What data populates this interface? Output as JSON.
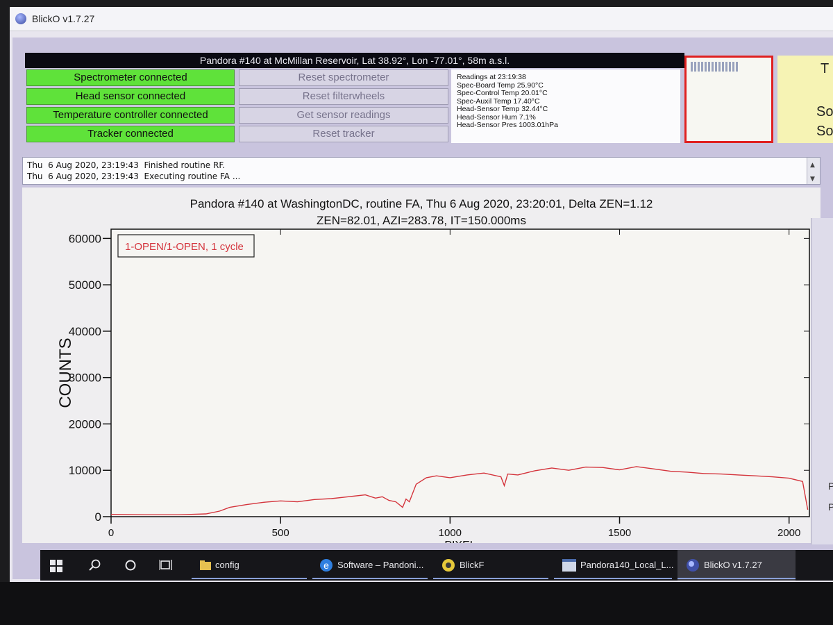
{
  "window": {
    "title": "BlickO v1.7.27"
  },
  "header": {
    "station": "Pandora #140 at McMillan Reservoir, Lat 38.92°, Lon -77.01°, 58m a.s.l.",
    "status": [
      {
        "label": "Spectrometer connected"
      },
      {
        "label": "Head sensor connected"
      },
      {
        "label": "Temperature controller connected"
      },
      {
        "label": "Tracker connected"
      }
    ],
    "actions": [
      {
        "label": "Reset spectrometer"
      },
      {
        "label": "Reset filterwheels"
      },
      {
        "label": "Get sensor readings"
      },
      {
        "label": "Reset tracker"
      }
    ],
    "readings": [
      "Readings at 23:19:38",
      "Spec-Board Temp 25.90°C",
      "Spec-Control Temp 20.01°C",
      "Spec-Auxil Temp 17.40°C",
      "Head-Sensor Temp 32.44°C",
      "Head-Sensor Hum 7.1%",
      "Head-Sensor Pres 1003.01hPa"
    ],
    "right_panel": {
      "t": "T",
      "s1": "So",
      "s2": "So"
    },
    "colors": {
      "connected": "#5fe23a",
      "mini_border": "#e02020"
    }
  },
  "log": {
    "lines": [
      "Thu  6 Aug 2020, 23:19:43  Finished routine RF.",
      "Thu  6 Aug 2020, 23:19:43  Executing routine FA ..."
    ],
    "scroll_up_icon": "chevron-up-icon",
    "scroll_down_icon": "chevron-down-icon"
  },
  "side_strip": {
    "a": "P",
    "b": "P"
  },
  "chart_data": {
    "type": "line",
    "title_line1": "Pandora #140 at WashingtonDC, routine FA, Thu  6 Aug 2020, 23:20:01, Delta ZEN=1.12",
    "title_line2": "ZEN=82.01, AZI=283.78, IT=150.000ms",
    "xlabel": "PIXEL",
    "ylabel": "COUNTS",
    "xlim": [
      0,
      2060
    ],
    "ylim": [
      0,
      62000
    ],
    "xticks": [
      0,
      500,
      1000,
      1500,
      2000
    ],
    "yticks": [
      0,
      10000,
      20000,
      30000,
      40000,
      50000,
      60000
    ],
    "legend": "1-OPEN/1-OPEN, 1 cycle",
    "legend_position": "top-left",
    "line_color": "#d4343c",
    "series": [
      {
        "x": [
          0,
          100,
          200,
          280,
          320,
          350,
          400,
          450,
          500,
          550,
          600,
          650,
          700,
          750,
          780,
          800,
          820,
          840,
          860,
          870,
          880,
          900,
          930,
          960,
          1000,
          1050,
          1100,
          1150,
          1160,
          1170,
          1200,
          1250,
          1300,
          1350,
          1400,
          1450,
          1500,
          1550,
          1600,
          1650,
          1700,
          1750,
          1800,
          1850,
          1900,
          1950,
          2000,
          2040,
          2055
        ],
        "y": [
          500,
          400,
          400,
          600,
          1200,
          2000,
          2600,
          3100,
          3400,
          3200,
          3700,
          3900,
          4300,
          4700,
          4000,
          4300,
          3500,
          3200,
          2000,
          3800,
          3200,
          7000,
          8400,
          8800,
          8400,
          9000,
          9400,
          8600,
          6700,
          9200,
          9000,
          9900,
          10500,
          10000,
          10700,
          10600,
          10100,
          10800,
          10300,
          9800,
          9600,
          9300,
          9200,
          9000,
          8800,
          8600,
          8300,
          7600,
          1500
        ]
      }
    ]
  },
  "taskbar": {
    "start_icon": "windows-logo-icon",
    "search_icon": "search-icon",
    "cortana_icon": "circle-icon",
    "taskview_icon": "task-view-icon",
    "apps": [
      {
        "label": "config",
        "icon": "folder-icon"
      },
      {
        "label": "Software – Pandoni...",
        "icon": "edge-icon"
      },
      {
        "label": "BlickF",
        "icon": "blickf-icon"
      },
      {
        "label": "Pandora140_Local_L...",
        "icon": "window-icon"
      },
      {
        "label": "BlickO v1.7.27",
        "icon": "blicko-icon"
      }
    ]
  }
}
